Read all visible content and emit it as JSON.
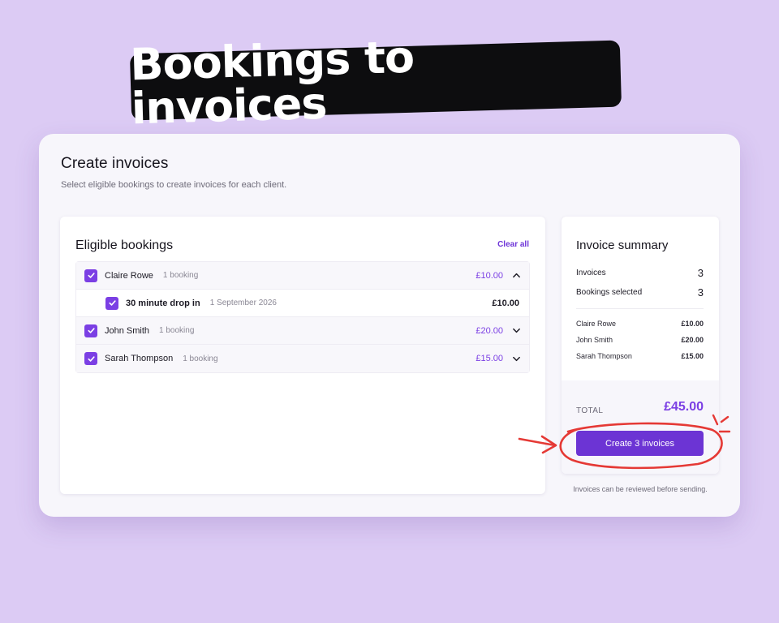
{
  "headline": "Bookings to invoices",
  "page": {
    "title": "Create invoices",
    "subtitle": "Select eligible bookings to create invoices for each client."
  },
  "bookings": {
    "title": "Eligible bookings",
    "clear_all": "Clear all",
    "clients": [
      {
        "name": "Claire Rowe",
        "meta": "1 booking",
        "amount": "£10.00",
        "checked": true,
        "expanded": true,
        "items": [
          {
            "name": "30 minute drop in",
            "date": "1 September 2026",
            "amount": "£10.00",
            "checked": true
          }
        ]
      },
      {
        "name": "John Smith",
        "meta": "1 booking",
        "amount": "£20.00",
        "checked": true,
        "expanded": false
      },
      {
        "name": "Sarah Thompson",
        "meta": "1 booking",
        "amount": "£15.00",
        "checked": true,
        "expanded": false
      }
    ]
  },
  "summary": {
    "title": "Invoice summary",
    "invoices_label": "Invoices",
    "invoices_count": "3",
    "bookings_label": "Bookings selected",
    "bookings_count": "3",
    "lines": [
      {
        "name": "Claire Rowe",
        "amount": "£10.00"
      },
      {
        "name": "John Smith",
        "amount": "£20.00"
      },
      {
        "name": "Sarah Thompson",
        "amount": "£15.00"
      }
    ],
    "total_label": "TOTAL",
    "total_value": "£45.00",
    "button_label": "Create 3 invoices",
    "footnote": "Invoices can be reviewed before sending."
  },
  "colors": {
    "background": "#dccbf4",
    "accent": "#7b3fe4",
    "button": "#6c34d4",
    "annotation": "#e53935"
  },
  "icons": {
    "checkbox": "check-icon",
    "expanded": "chevron-up-icon",
    "collapsed": "chevron-down-icon"
  }
}
